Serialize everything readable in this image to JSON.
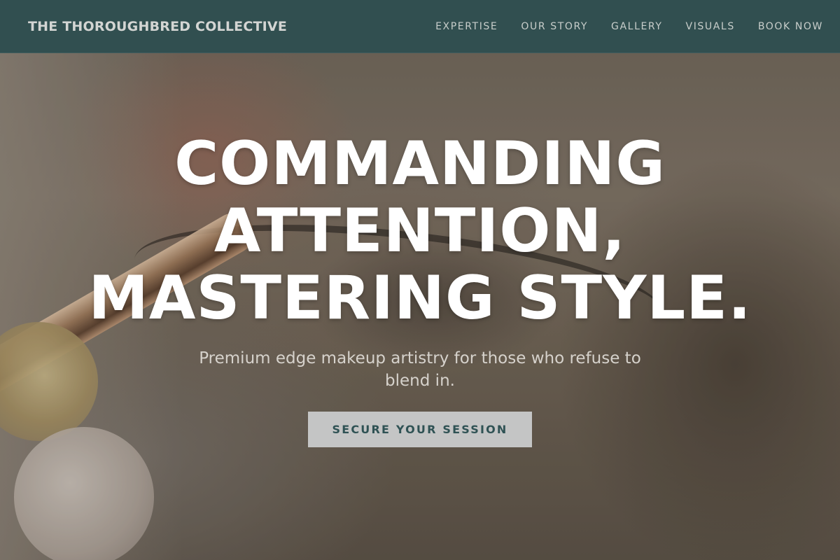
{
  "header": {
    "brand": "THE THOROUGHBRED COLLECTIVE",
    "nav": [
      {
        "label": "EXPERTISE"
      },
      {
        "label": "OUR STORY"
      },
      {
        "label": "GALLERY"
      },
      {
        "label": "VISUALS"
      },
      {
        "label": "BOOK NOW"
      }
    ]
  },
  "hero": {
    "headline_lines": [
      "COMMANDING",
      "ATTENTION,",
      "MASTERING STYLE."
    ],
    "subtitle": "Premium edge makeup artistry for those who refuse to blend in.",
    "cta_label": "SECURE YOUR SESSION",
    "background_image": "close-up-eye-makeup-brush-photo"
  },
  "colors": {
    "navbar": "#2c4e50",
    "cta_background": "#c4c5c5",
    "cta_text": "#2f5254",
    "headline": "#ffffff"
  }
}
